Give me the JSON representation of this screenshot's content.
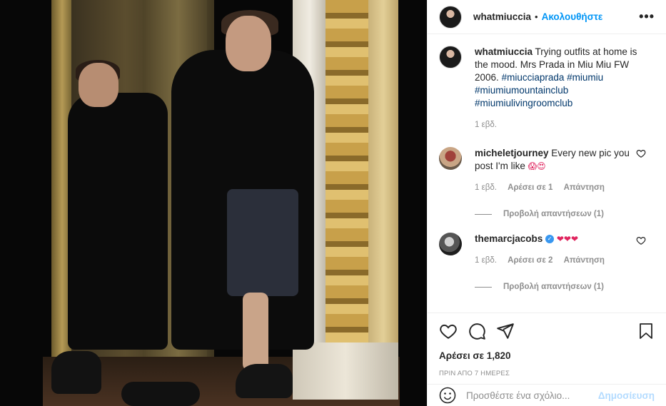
{
  "post": {
    "username": "whatmiuccia",
    "follow_label": "Ακολουθήστε",
    "separator": "•",
    "more_label": "•••"
  },
  "caption": {
    "username": "whatmiuccia",
    "text": "Trying outfits at home is the mood. Mrs Prada in Miu Miu FW 2006.",
    "hashtags": [
      "#miucciaprada",
      "#miumiu",
      "#miumiumountainclub",
      "#miumiulivingroomclub"
    ],
    "time": "1 εβδ."
  },
  "comments": [
    {
      "username": "micheletjourney",
      "text": "Every new pic you post I'm like",
      "emoji": "😱😍",
      "time": "1 εβδ.",
      "likes": "Αρέσει σε 1",
      "reply": "Απάντηση",
      "view_replies": "Προβολή απαντήσεων (1)"
    },
    {
      "username": "themarcjacobs",
      "verified": true,
      "text": "",
      "emoji": "❤❤❤",
      "time": "1 εβδ.",
      "likes": "Αρέσει σε 2",
      "reply": "Απάντηση",
      "view_replies": "Προβολή απαντήσεων (1)"
    }
  ],
  "actions": {
    "likes_text": "Αρέσει σε 1,820",
    "date_text": "ΠΡΙΝ ΑΠΟ 7 ΗΜΕΡΕΣ"
  },
  "add_comment": {
    "placeholder": "Προσθέστε ένα σχόλιο...",
    "post_label": "Δημοσίευση"
  },
  "icons": {
    "like": "heart-icon",
    "comment": "comment-icon",
    "share": "share-icon",
    "save": "bookmark-icon",
    "emoji": "emoji-icon",
    "more": "more-icon"
  }
}
